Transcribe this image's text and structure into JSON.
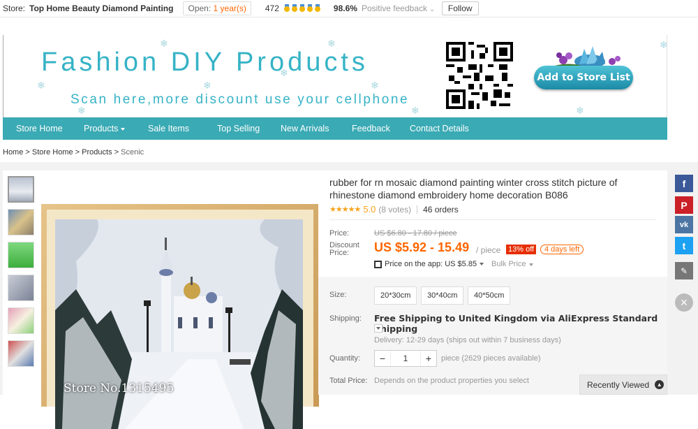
{
  "store_bar": {
    "label": "Store:",
    "name": "Top Home Beauty Diamond Painting",
    "open_prefix": "Open:",
    "open_years": "1 year(s)",
    "score": "472",
    "feedback_pct": "98.6%",
    "feedback_label": "Positive feedback",
    "follow": "Follow"
  },
  "banner": {
    "title": "Fashion DIY Products",
    "subtitle": "Scan here,more discount use your cellphone",
    "add_store": "Add to Store List"
  },
  "nav": {
    "items": [
      "Store Home",
      "Products",
      "Sale Items",
      "Top Selling",
      "New Arrivals",
      "Feedback",
      "Contact Details"
    ]
  },
  "breadcrumb": {
    "items": [
      "Home",
      "Store Home",
      "Products",
      "Scenic"
    ],
    "separator": ">"
  },
  "gallery": {
    "watermark": "Store No.1315495"
  },
  "product": {
    "title": "rubber for rn mosaic diamond painting winter cross stitch picture of rhinestone diamond embroidery home decoration B086",
    "rating": "5.0",
    "votes": "(8 votes)",
    "orders": "46 orders",
    "stars_count": 5,
    "price_label": "Price:",
    "old_price": "US $6.80 - 17.80 / piece",
    "discount_label": "Discount Price:",
    "price": "US $5.92 - 15.49",
    "per_piece": "/ piece",
    "off_badge": "13% off",
    "days_left": "4 days left",
    "app_price": "Price on the app: US $5.85",
    "bulk_price": "Bulk Price",
    "size_label": "Size:",
    "sizes": [
      "20*30cm",
      "30*40cm",
      "40*50cm"
    ],
    "shipping_label": "Shipping:",
    "shipping": "Free Shipping to United Kingdom via AliExpress Standard Shipping",
    "delivery": "Delivery: 12-29 days (ships out within 7 business days)",
    "quantity_label": "Quantity:",
    "quantity": "1",
    "minus": "−",
    "plus": "+",
    "availability": "piece (2629 pieces available)",
    "total_label": "Total Price:",
    "total_value": "Depends on the product properties you select"
  },
  "social": {
    "facebook": "f",
    "pinterest": "P",
    "vk": "vk",
    "twitter": "t",
    "close": "×",
    "colors": {
      "facebook": "#3b5998",
      "pinterest": "#cb2027",
      "vk": "#4c75a3",
      "twitter": "#1da1f2",
      "edit": "#777"
    }
  },
  "recently_viewed": "Recently Viewed",
  "colors": {
    "accent": "#3aaab4",
    "price": "#ff6600",
    "badge": "#e62e04"
  }
}
